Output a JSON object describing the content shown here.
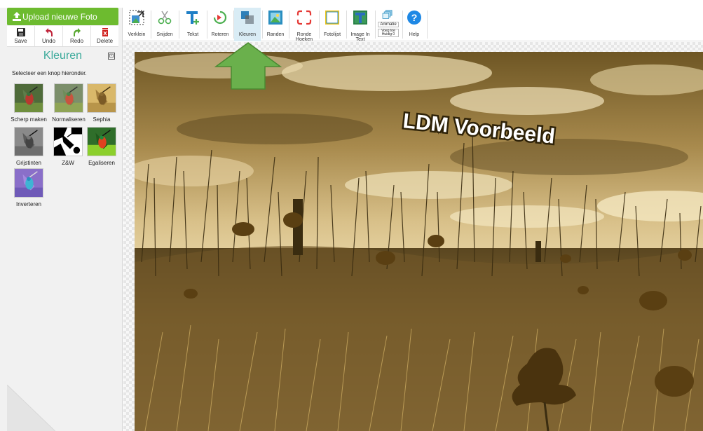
{
  "sidebar": {
    "upload_label": "Upload nieuwe Foto",
    "actions": [
      {
        "label": "Save",
        "icon": "floppy-disk-icon"
      },
      {
        "label": "Undo",
        "icon": "undo-arrow-icon"
      },
      {
        "label": "Redo",
        "icon": "redo-arrow-icon"
      },
      {
        "label": "Delete",
        "icon": "trash-icon"
      }
    ],
    "panel_title": "Kleuren",
    "collapse_symbol": "⊡",
    "hint": "Selecteer een knop hieronder.",
    "effects": [
      {
        "label": "Scherp maken",
        "icon": "hummingbird-sharpen-thumbnail"
      },
      {
        "label": "Normaliseren",
        "icon": "hummingbird-normalize-thumbnail"
      },
      {
        "label": "Sephia",
        "icon": "hummingbird-sepia-thumbnail"
      },
      {
        "label": "Grijstinten",
        "icon": "hummingbird-grayscale-thumbnail"
      },
      {
        "label": "Z&W",
        "icon": "hummingbird-black-white-thumbnail"
      },
      {
        "label": "Egaliseren",
        "icon": "hummingbird-equalize-thumbnail"
      },
      {
        "label": "Inverteren",
        "icon": "hummingbird-invert-thumbnail"
      }
    ]
  },
  "toolbar": {
    "tools": [
      {
        "label": "Verklein",
        "icon": "resize-icon"
      },
      {
        "label": "Snijden",
        "icon": "scissors-icon"
      },
      {
        "label": "Tekst",
        "icon": "text-t-icon"
      },
      {
        "label": "Roteren",
        "icon": "rotate-icon"
      },
      {
        "label": "Kleuren",
        "icon": "colors-icon",
        "selected": true
      },
      {
        "label": "Randen",
        "icon": "frame-picture-icon"
      },
      {
        "label": "Ronde Hoeken",
        "icon": "rounded-corners-icon"
      },
      {
        "label": "Fotolijst",
        "icon": "photo-frame-icon"
      },
      {
        "label": "Image In Text",
        "icon": "image-in-text-icon"
      },
      {
        "label": "Animatie",
        "sublabel": "Voeg toe Huidig 0",
        "icon": "animation-icon"
      },
      {
        "label": "Help",
        "icon": "help-icon"
      }
    ]
  },
  "canvas": {
    "overlay_text": "LDM Voorbeeld"
  },
  "colors": {
    "upload_green": "#6dbb2f",
    "title_teal": "#3aa99a",
    "arrow_green": "#6ab04c",
    "selected_tool": "#d9ecf5",
    "sepia_dark": "#2e2208",
    "sepia_light": "#e8d6a8"
  }
}
